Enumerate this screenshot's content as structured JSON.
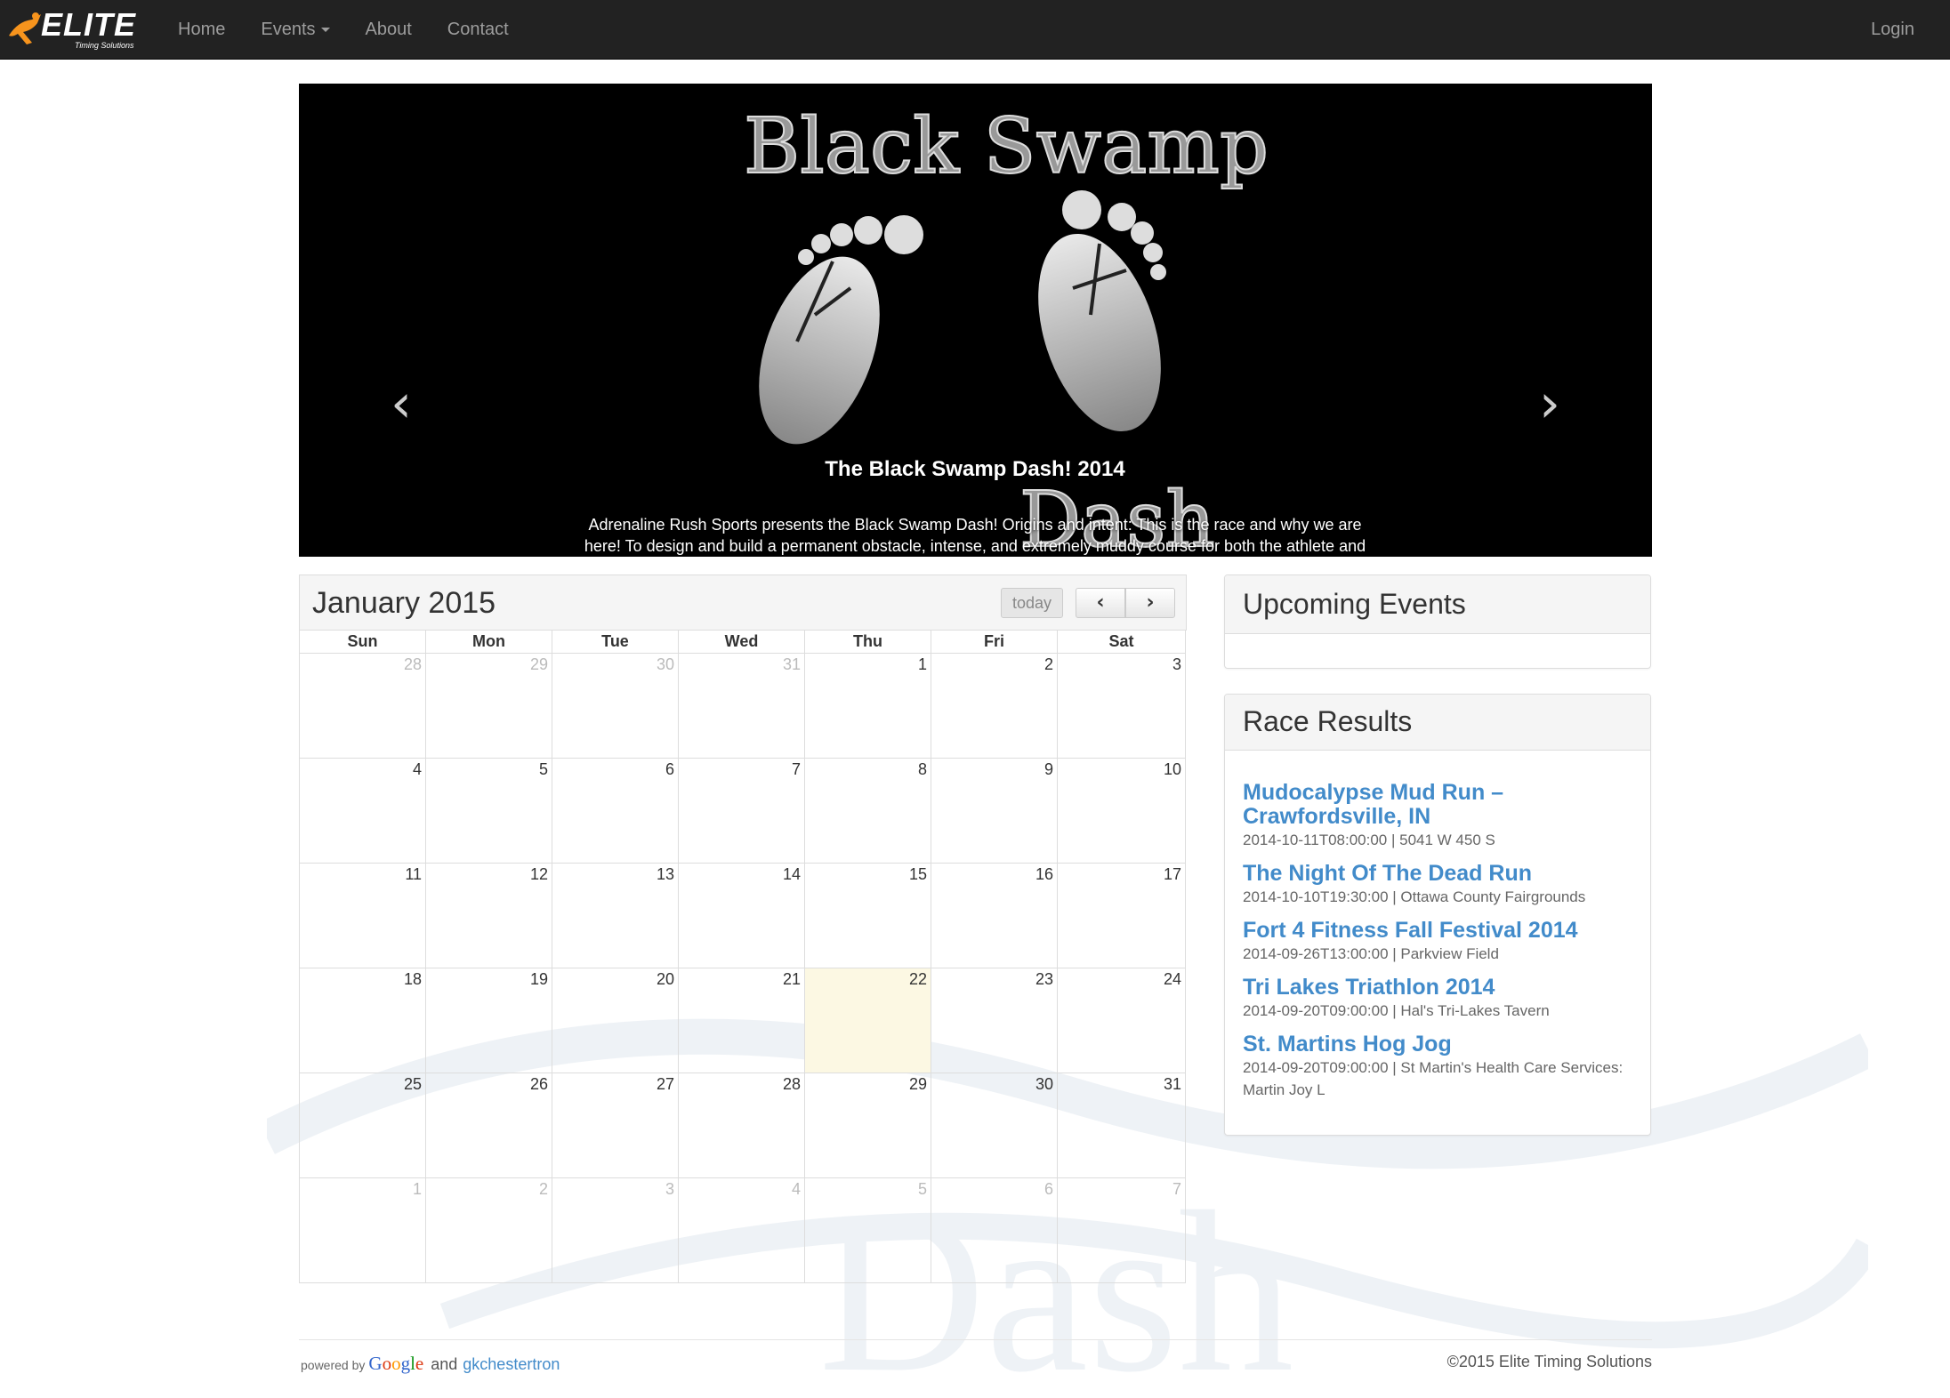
{
  "navbar": {
    "brand_main": "ELITE",
    "brand_sub": "Timing Solutions",
    "items": [
      {
        "label": "Home"
      },
      {
        "label": "Events"
      },
      {
        "label": "About"
      },
      {
        "label": "Contact"
      }
    ],
    "login_label": "Login"
  },
  "carousel": {
    "caption_title": "The Black Swamp Dash! 2014",
    "caption_text": "Adrenaline Rush Sports presents the Black Swamp Dash! Origins and intent: This is the race and why we are here! To design and build a permanent obstacle, intense, and extremely muddy course for both the athlete and non-athlete alike. Run it for your bes...",
    "prev_label": "‹",
    "next_label": "›",
    "slide_count": 15,
    "active_index": 6,
    "image_title_top": "Black Swamp",
    "image_title_bottom": "Dash"
  },
  "calendar": {
    "title": "January 2015",
    "today_label": "today",
    "prev_label": "‹",
    "next_label": "›",
    "day_names": [
      "Sun",
      "Mon",
      "Tue",
      "Wed",
      "Thu",
      "Fri",
      "Sat"
    ],
    "weeks": [
      [
        {
          "d": "28",
          "o": true
        },
        {
          "d": "29",
          "o": true
        },
        {
          "d": "30",
          "o": true
        },
        {
          "d": "31",
          "o": true
        },
        {
          "d": "1"
        },
        {
          "d": "2"
        },
        {
          "d": "3"
        }
      ],
      [
        {
          "d": "4"
        },
        {
          "d": "5"
        },
        {
          "d": "6"
        },
        {
          "d": "7"
        },
        {
          "d": "8"
        },
        {
          "d": "9"
        },
        {
          "d": "10"
        }
      ],
      [
        {
          "d": "11"
        },
        {
          "d": "12"
        },
        {
          "d": "13"
        },
        {
          "d": "14"
        },
        {
          "d": "15"
        },
        {
          "d": "16"
        },
        {
          "d": "17"
        }
      ],
      [
        {
          "d": "18"
        },
        {
          "d": "19"
        },
        {
          "d": "20"
        },
        {
          "d": "21"
        },
        {
          "d": "22",
          "t": true
        },
        {
          "d": "23"
        },
        {
          "d": "24"
        }
      ],
      [
        {
          "d": "25"
        },
        {
          "d": "26"
        },
        {
          "d": "27"
        },
        {
          "d": "28"
        },
        {
          "d": "29"
        },
        {
          "d": "30"
        },
        {
          "d": "31"
        }
      ],
      [
        {
          "d": "1",
          "o": true
        },
        {
          "d": "2",
          "o": true
        },
        {
          "d": "3",
          "o": true
        },
        {
          "d": "4",
          "o": true
        },
        {
          "d": "5",
          "o": true
        },
        {
          "d": "6",
          "o": true
        },
        {
          "d": "7",
          "o": true
        }
      ]
    ]
  },
  "upcoming": {
    "heading": "Upcoming Events"
  },
  "results": {
    "heading": "Race Results",
    "items": [
      {
        "title": "Mudocalypse Mud Run – Crawfordsville, IN",
        "meta": "2014-10-11T08:00:00 | 5041 W 450 S"
      },
      {
        "title": "The Night Of The Dead Run",
        "meta": "2014-10-10T19:30:00 | Ottawa County Fairgrounds"
      },
      {
        "title": "Fort 4 Fitness Fall Festival 2014",
        "meta": "2014-09-26T13:00:00 | Parkview Field"
      },
      {
        "title": "Tri Lakes Triathlon 2014",
        "meta": "2014-09-20T09:00:00 | Hal's Tri-Lakes Tavern"
      },
      {
        "title": "St. Martins Hog Jog",
        "meta": "2014-09-20T09:00:00 | St Martin's Health Care Services: Martin Joy L"
      }
    ]
  },
  "footer": {
    "powered_by": "powered by",
    "google": "Google",
    "and": "and",
    "author": "gkchestertron",
    "copyright": "©2015 Elite Timing Solutions"
  },
  "colors": {
    "navbar_bg": "#222222",
    "link": "#428bca",
    "today_bg": "#fcf8e3",
    "brand_accent": "#f7941d"
  }
}
